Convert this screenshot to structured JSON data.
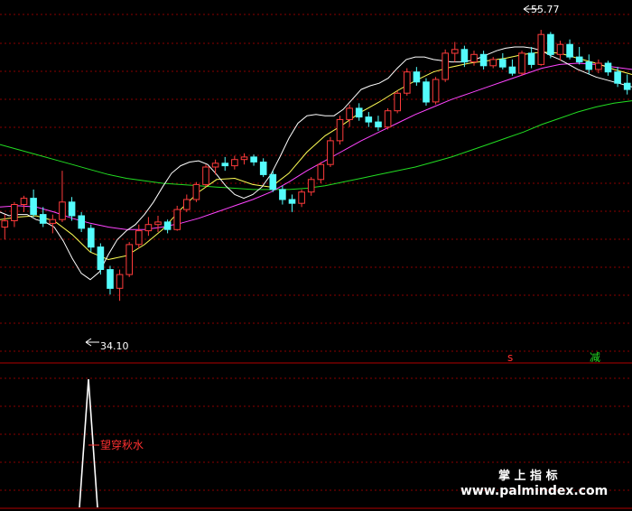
{
  "chart_data": {
    "type": "candlestick",
    "price_range": [
      30,
      57
    ],
    "annotations": {
      "high_label": "55.77",
      "low_label": "34.10",
      "indicator_label": "望穿秋水",
      "signal_s": "s",
      "signal_jian": "减"
    },
    "watermark": {
      "line1": "掌 上 指 标",
      "line2": "www.palmindex.com"
    },
    "colors": {
      "up": "#ff3b3b",
      "down": "#54fcfc",
      "ma5": "#ffffff",
      "ma10": "#ffff55",
      "ma30": "#ff44ff",
      "ma60": "#22dd22",
      "grid": "#8a0000",
      "indicator_line": "#ffffff",
      "label_red": "#ff3030",
      "label_green": "#22dd22"
    },
    "candles": [
      [
        40.0,
        41.0,
        39.0,
        40.5
      ],
      [
        40.5,
        42.0,
        40.0,
        41.8
      ],
      [
        41.8,
        42.5,
        41.2,
        42.3
      ],
      [
        42.3,
        43.0,
        40.8,
        41.0
      ],
      [
        41.0,
        41.6,
        40.0,
        40.3
      ],
      [
        40.3,
        41.0,
        39.5,
        40.6
      ],
      [
        40.6,
        44.5,
        40.4,
        42.0
      ],
      [
        42.0,
        42.4,
        40.5,
        40.9
      ],
      [
        40.9,
        41.2,
        39.6,
        39.9
      ],
      [
        39.9,
        40.2,
        38.0,
        38.4
      ],
      [
        38.4,
        38.7,
        36.2,
        36.6
      ],
      [
        36.6,
        36.9,
        34.6,
        35.1
      ],
      [
        35.1,
        36.6,
        34.1,
        36.2
      ],
      [
        36.2,
        38.8,
        36.0,
        38.6
      ],
      [
        38.6,
        40.2,
        38.3,
        39.7
      ],
      [
        39.7,
        40.8,
        39.3,
        40.2
      ],
      [
        40.2,
        40.9,
        39.6,
        40.4
      ],
      [
        40.4,
        40.6,
        39.5,
        39.8
      ],
      [
        39.8,
        41.7,
        39.7,
        41.4
      ],
      [
        41.4,
        42.6,
        41.2,
        42.2
      ],
      [
        42.2,
        43.6,
        42.0,
        43.4
      ],
      [
        43.4,
        45.0,
        43.2,
        44.8
      ],
      [
        44.8,
        45.4,
        44.2,
        45.1
      ],
      [
        45.1,
        45.6,
        44.5,
        44.9
      ],
      [
        44.9,
        45.7,
        44.6,
        45.4
      ],
      [
        45.4,
        45.9,
        45.0,
        45.6
      ],
      [
        45.6,
        45.8,
        44.9,
        45.2
      ],
      [
        45.2,
        45.5,
        44.0,
        44.2
      ],
      [
        44.2,
        44.5,
        42.8,
        43.0
      ],
      [
        43.0,
        43.3,
        41.8,
        42.2
      ],
      [
        42.2,
        42.6,
        41.2,
        41.9
      ],
      [
        41.9,
        43.0,
        41.6,
        42.8
      ],
      [
        42.8,
        44.0,
        42.5,
        43.8
      ],
      [
        43.8,
        45.2,
        43.5,
        45.0
      ],
      [
        45.0,
        47.2,
        44.8,
        46.9
      ],
      [
        46.9,
        48.9,
        46.6,
        48.6
      ],
      [
        48.6,
        49.8,
        48.0,
        49.5
      ],
      [
        49.5,
        49.9,
        48.5,
        48.8
      ],
      [
        48.8,
        49.2,
        48.0,
        48.4
      ],
      [
        48.4,
        48.9,
        47.7,
        48.0
      ],
      [
        48.0,
        49.5,
        47.8,
        49.3
      ],
      [
        49.3,
        50.9,
        49.1,
        50.7
      ],
      [
        50.7,
        52.7,
        50.5,
        52.4
      ],
      [
        52.4,
        52.8,
        51.3,
        51.6
      ],
      [
        51.6,
        51.9,
        49.7,
        50.0
      ],
      [
        50.0,
        52.0,
        49.8,
        51.8
      ],
      [
        51.8,
        54.2,
        51.6,
        53.9
      ],
      [
        53.9,
        54.8,
        53.2,
        54.2
      ],
      [
        54.2,
        54.5,
        52.8,
        53.2
      ],
      [
        53.2,
        54.1,
        52.9,
        53.8
      ],
      [
        53.8,
        54.1,
        52.6,
        52.9
      ],
      [
        52.9,
        53.6,
        52.7,
        53.4
      ],
      [
        53.4,
        53.9,
        52.6,
        52.8
      ],
      [
        52.8,
        53.4,
        52.1,
        52.3
      ],
      [
        52.3,
        54.1,
        52.1,
        53.9
      ],
      [
        53.9,
        54.4,
        52.7,
        53.0
      ],
      [
        53.0,
        55.77,
        52.9,
        55.4
      ],
      [
        55.4,
        55.6,
        53.5,
        53.8
      ],
      [
        53.8,
        54.9,
        53.3,
        54.6
      ],
      [
        54.6,
        55.0,
        53.4,
        53.6
      ],
      [
        53.6,
        54.4,
        53.0,
        53.2
      ],
      [
        53.2,
        53.8,
        52.2,
        52.6
      ],
      [
        52.6,
        53.4,
        52.3,
        53.1
      ],
      [
        53.1,
        53.3,
        52.1,
        52.4
      ],
      [
        52.4,
        52.8,
        51.2,
        51.5
      ],
      [
        51.5,
        52.2,
        50.6,
        51.0
      ]
    ],
    "ma5": [
      [
        0,
        41.2
      ],
      [
        10,
        40.9
      ],
      [
        20,
        41.0
      ],
      [
        30,
        41.0
      ],
      [
        40,
        40.6
      ],
      [
        50,
        40.4
      ],
      [
        60,
        40.0
      ],
      [
        70,
        38.9
      ],
      [
        80,
        37.5
      ],
      [
        90,
        36.3
      ],
      [
        100,
        35.8
      ],
      [
        110,
        36.4
      ],
      [
        120,
        37.8
      ],
      [
        130,
        39.0
      ],
      [
        140,
        39.7
      ],
      [
        150,
        40.2
      ],
      [
        160,
        41.0
      ],
      [
        170,
        42.0
      ],
      [
        180,
        43.2
      ],
      [
        190,
        44.3
      ],
      [
        200,
        44.9
      ],
      [
        210,
        45.2
      ],
      [
        220,
        45.3
      ],
      [
        230,
        45.0
      ],
      [
        240,
        44.2
      ],
      [
        250,
        43.3
      ],
      [
        260,
        42.6
      ],
      [
        270,
        42.3
      ],
      [
        280,
        42.6
      ],
      [
        290,
        43.2
      ],
      [
        300,
        44.2
      ],
      [
        310,
        45.6
      ],
      [
        320,
        47.1
      ],
      [
        330,
        48.3
      ],
      [
        340,
        48.9
      ],
      [
        350,
        49.0
      ],
      [
        360,
        48.9
      ],
      [
        370,
        48.9
      ],
      [
        380,
        49.4
      ],
      [
        390,
        50.2
      ],
      [
        400,
        51.0
      ],
      [
        410,
        51.3
      ],
      [
        420,
        51.5
      ],
      [
        430,
        51.9
      ],
      [
        440,
        52.7
      ],
      [
        450,
        53.4
      ],
      [
        460,
        53.6
      ],
      [
        470,
        53.6
      ],
      [
        480,
        53.4
      ],
      [
        490,
        53.3
      ],
      [
        500,
        53.2
      ],
      [
        510,
        53.2
      ],
      [
        520,
        53.3
      ],
      [
        530,
        53.5
      ],
      [
        540,
        53.8
      ],
      [
        550,
        54.1
      ],
      [
        560,
        54.3
      ],
      [
        570,
        54.4
      ],
      [
        580,
        54.4
      ],
      [
        590,
        54.3
      ],
      [
        600,
        54.1
      ],
      [
        610,
        53.7
      ],
      [
        620,
        53.4
      ],
      [
        630,
        53.0
      ],
      [
        640,
        52.6
      ],
      [
        650,
        52.3
      ],
      [
        660,
        52.0
      ],
      [
        680,
        51.6
      ],
      [
        700,
        51.2
      ]
    ],
    "ma10": [
      [
        0,
        40.6
      ],
      [
        20,
        40.8
      ],
      [
        40,
        40.9
      ],
      [
        60,
        40.5
      ],
      [
        80,
        39.4
      ],
      [
        100,
        38.0
      ],
      [
        120,
        37.4
      ],
      [
        140,
        37.7
      ],
      [
        160,
        38.6
      ],
      [
        180,
        39.8
      ],
      [
        200,
        41.4
      ],
      [
        220,
        42.8
      ],
      [
        240,
        43.8
      ],
      [
        260,
        43.9
      ],
      [
        280,
        43.4
      ],
      [
        300,
        43.2
      ],
      [
        320,
        44.3
      ],
      [
        340,
        46.0
      ],
      [
        360,
        47.3
      ],
      [
        380,
        48.2
      ],
      [
        400,
        49.2
      ],
      [
        420,
        50.0
      ],
      [
        440,
        50.9
      ],
      [
        460,
        51.7
      ],
      [
        480,
        52.4
      ],
      [
        500,
        52.8
      ],
      [
        520,
        53.1
      ],
      [
        540,
        53.3
      ],
      [
        560,
        53.5
      ],
      [
        580,
        53.8
      ],
      [
        600,
        54.0
      ],
      [
        620,
        53.9
      ],
      [
        640,
        53.5
      ],
      [
        660,
        53.1
      ],
      [
        680,
        52.6
      ],
      [
        700,
        52.2
      ]
    ],
    "ma30": [
      [
        0,
        41.6
      ],
      [
        20,
        41.7
      ],
      [
        40,
        41.6
      ],
      [
        60,
        41.2
      ],
      [
        80,
        40.7
      ],
      [
        100,
        40.3
      ],
      [
        120,
        40.0
      ],
      [
        140,
        39.8
      ],
      [
        160,
        39.8
      ],
      [
        180,
        40.0
      ],
      [
        200,
        40.3
      ],
      [
        220,
        40.7
      ],
      [
        240,
        41.2
      ],
      [
        260,
        41.7
      ],
      [
        280,
        42.2
      ],
      [
        300,
        42.8
      ],
      [
        320,
        43.6
      ],
      [
        340,
        44.5
      ],
      [
        360,
        45.3
      ],
      [
        380,
        46.1
      ],
      [
        400,
        46.9
      ],
      [
        420,
        47.6
      ],
      [
        440,
        48.3
      ],
      [
        460,
        49.0
      ],
      [
        480,
        49.6
      ],
      [
        500,
        50.2
      ],
      [
        520,
        50.7
      ],
      [
        540,
        51.2
      ],
      [
        560,
        51.7
      ],
      [
        580,
        52.2
      ],
      [
        600,
        52.7
      ],
      [
        620,
        53.0
      ],
      [
        640,
        53.1
      ],
      [
        660,
        53.0
      ],
      [
        680,
        52.8
      ],
      [
        700,
        52.6
      ]
    ],
    "ma60": [
      [
        0,
        46.6
      ],
      [
        20,
        46.2
      ],
      [
        40,
        45.8
      ],
      [
        60,
        45.4
      ],
      [
        80,
        45.0
      ],
      [
        100,
        44.6
      ],
      [
        120,
        44.2
      ],
      [
        140,
        43.9
      ],
      [
        160,
        43.7
      ],
      [
        180,
        43.5
      ],
      [
        200,
        43.4
      ],
      [
        220,
        43.3
      ],
      [
        240,
        43.2
      ],
      [
        260,
        43.1
      ],
      [
        280,
        43.0
      ],
      [
        300,
        43.0
      ],
      [
        320,
        43.0
      ],
      [
        340,
        43.1
      ],
      [
        360,
        43.3
      ],
      [
        380,
        43.6
      ],
      [
        400,
        43.9
      ],
      [
        420,
        44.2
      ],
      [
        440,
        44.5
      ],
      [
        460,
        44.8
      ],
      [
        480,
        45.2
      ],
      [
        500,
        45.6
      ],
      [
        520,
        46.1
      ],
      [
        540,
        46.6
      ],
      [
        560,
        47.1
      ],
      [
        580,
        47.6
      ],
      [
        600,
        48.2
      ],
      [
        620,
        48.7
      ],
      [
        640,
        49.2
      ],
      [
        660,
        49.6
      ],
      [
        680,
        49.9
      ],
      [
        700,
        50.1
      ]
    ]
  }
}
